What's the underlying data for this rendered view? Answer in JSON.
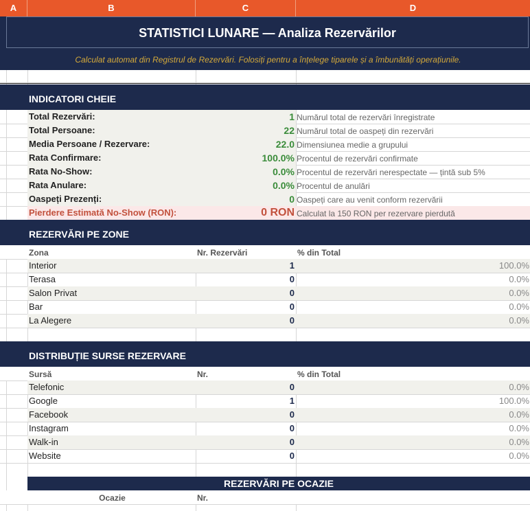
{
  "columns": [
    "A",
    "B",
    "C",
    "D"
  ],
  "title": "STATISTICI LUNARE  —  Analiza Rezervărilor",
  "subtitle": "Calculat automat din Registrul de Rezervări. Folosiți pentru a înțelege tiparele și a îmbunătăți operațiunile.",
  "kpi_section": {
    "title": "INDICATORI CHEIE",
    "rows": [
      {
        "label": "Total Rezervări:",
        "value": "1",
        "desc": "Numărul total de rezervări înregistrate"
      },
      {
        "label": "Total Persoane:",
        "value": "22",
        "desc": "Numărul total de oaspeți din rezervări"
      },
      {
        "label": "Media Persoane / Rezervare:",
        "value": "22.0",
        "desc": "Dimensiunea medie a grupului"
      },
      {
        "label": "Rata Confirmare:",
        "value": "100.0%",
        "desc": "Procentul de rezervări confirmate"
      },
      {
        "label": "Rata No-Show:",
        "value": "0.0%",
        "desc": "Procentul de rezervări nerespectate — țintă sub 5%"
      },
      {
        "label": "Rata Anulare:",
        "value": "0.0%",
        "desc": "Procentul de anulări"
      },
      {
        "label": "Oaspeți Prezenți:",
        "value": "0",
        "desc": "Oaspeți care au venit conform rezervării"
      },
      {
        "label": "Pierdere Estimată No-Show (RON):",
        "value": "0 RON",
        "desc": "Calculat la 150 RON per rezervare pierdută"
      }
    ]
  },
  "zones_section": {
    "title": "REZERVĂRI PE ZONE",
    "headers": [
      "Zona",
      "Nr. Rezervări",
      "% din Total"
    ],
    "rows": [
      {
        "name": "Interior",
        "count": "1",
        "pct": "100.0%"
      },
      {
        "name": "Terasa",
        "count": "0",
        "pct": "0.0%"
      },
      {
        "name": "Salon Privat",
        "count": "0",
        "pct": "0.0%"
      },
      {
        "name": "Bar",
        "count": "0",
        "pct": "0.0%"
      },
      {
        "name": "La Alegere",
        "count": "0",
        "pct": "0.0%"
      }
    ]
  },
  "sources_section": {
    "title": "DISTRIBUȚIE SURSE REZERVARE",
    "headers": [
      "Sursă",
      "Nr.",
      "% din Total"
    ],
    "rows": [
      {
        "name": "Telefonic",
        "count": "0",
        "pct": "0.0%"
      },
      {
        "name": "Google",
        "count": "1",
        "pct": "100.0%"
      },
      {
        "name": "Facebook",
        "count": "0",
        "pct": "0.0%"
      },
      {
        "name": "Instagram",
        "count": "0",
        "pct": "0.0%"
      },
      {
        "name": "Walk-in",
        "count": "0",
        "pct": "0.0%"
      },
      {
        "name": "Website",
        "count": "0",
        "pct": "0.0%"
      }
    ]
  },
  "occasion_section": {
    "title": "REZERVĂRI PE OCAZIE",
    "headers": [
      "Ocazie",
      "Nr."
    ]
  },
  "colors": {
    "navy": "#1d2a4c",
    "orange": "#e8582a",
    "gold": "#d4a93a",
    "green": "#3a8c3a",
    "red": "#c2513d"
  }
}
